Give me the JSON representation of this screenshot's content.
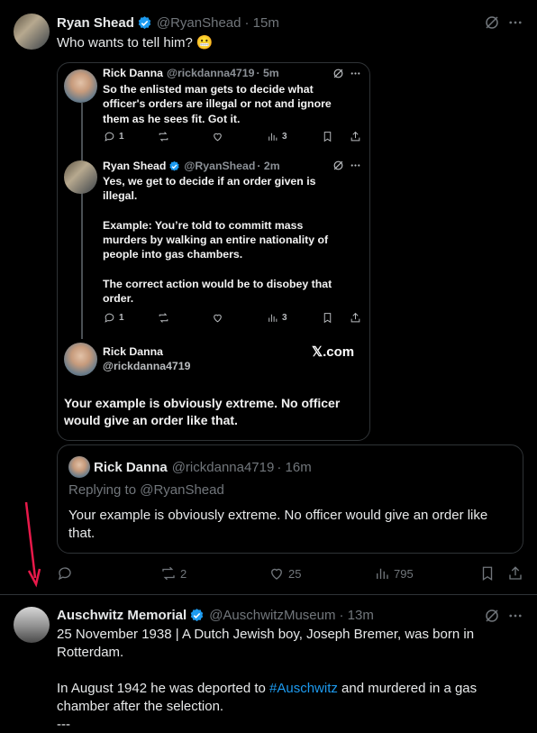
{
  "main_tweet": {
    "author_name": "Ryan Shead",
    "handle": "@RyanShead",
    "time": "· 15m",
    "text": "Who wants to tell him?",
    "emoji": "😬"
  },
  "embedded_screenshot": {
    "tweet1": {
      "author_name": "Rick Danna",
      "handle": "@rickdanna4719",
      "time": "· 5m",
      "text_lines": [
        "So the enlisted man gets to decide what",
        "officer's orders are illegal or not and ignore",
        "them as he sees fit. Got it."
      ],
      "replies": "1",
      "views": "3"
    },
    "tweet2": {
      "author_name": "Ryan Shead",
      "handle": "@RyanShead",
      "time": "· 2m",
      "text_lines": [
        "Yes, we get to decide if an order given is",
        "illegal.",
        "",
        "Example: You’re told to committ mass",
        "murders by walking an entire nationality of",
        "people into gas chambers.",
        "",
        "The correct action would be to disobey that",
        "order."
      ],
      "replies": "1",
      "views": "3"
    },
    "card": {
      "author_name": "Rick Danna",
      "handle": "@rickdanna4719",
      "brand": "𝕏.com",
      "text_lines": [
        "Your example is obviously extreme. No officer",
        "would give an order like that."
      ]
    }
  },
  "quoted_tweet": {
    "author_name": "Rick Danna",
    "handle": "@rickdanna4719",
    "time": "· 16m",
    "replying_to": "Replying to @RyanShead",
    "text_lines": [
      "Your example is obviously extreme. No officer would give an order like",
      "that."
    ]
  },
  "main_actions": {
    "replies": "",
    "retweets": "2",
    "likes": "25",
    "views": "795"
  },
  "next_tweet": {
    "author_name": "Auschwitz Memorial",
    "handle": "@AuschwitzMuseum",
    "time": "· 13m",
    "line1": "25 November 1938 | A Dutch Jewish boy, Joseph Bremer, was born in",
    "line2": "Rotterdam.",
    "line3_prefix": "In August 1942 he was deported to ",
    "line3_link": "#Auschwitz",
    "line3_suffix": " and murdered in a gas",
    "line4": "chamber after the selection.",
    "line5": "---"
  },
  "annotation": {
    "arrow_color": "#e8194a"
  },
  "colors": {
    "background": "#000000",
    "text": "#e7e9ea",
    "muted": "#71767b",
    "link": "#1d9bf0",
    "verified": "#1d9bf0",
    "border": "#2f3336"
  }
}
